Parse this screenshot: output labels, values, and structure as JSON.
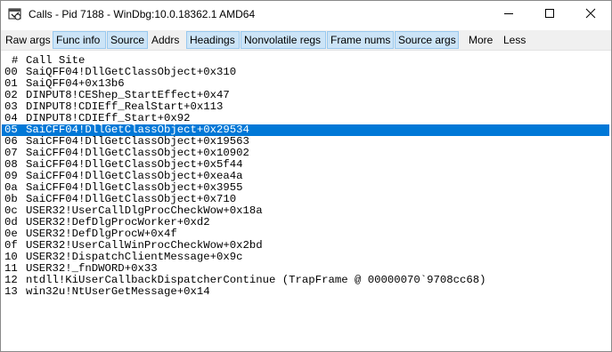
{
  "window": {
    "title": "Calls - Pid 7188 - WinDbg:10.0.18362.1 AMD64",
    "icons": [
      "windbg-app-icon",
      "minimize-icon",
      "maximize-icon",
      "close-icon"
    ]
  },
  "toolbar": {
    "buttons": [
      {
        "label": "Raw args",
        "active": false
      },
      {
        "label": "Func info",
        "active": true
      },
      {
        "label": "Source",
        "active": true
      },
      {
        "label": "Addrs",
        "active": false
      },
      {
        "label": "Headings",
        "active": true
      },
      {
        "label": "Nonvolatile regs",
        "active": true
      },
      {
        "label": "Frame nums",
        "active": true
      },
      {
        "label": "Source args",
        "active": true
      },
      {
        "label": "More",
        "active": false
      },
      {
        "label": "Less",
        "active": false
      }
    ]
  },
  "callstack": {
    "header": {
      "hash": "#",
      "label": "Call Site"
    },
    "selected_frame": "05",
    "frames": [
      {
        "num": "00",
        "site": "SaiQFF04!DllGetClassObject+0x310"
      },
      {
        "num": "01",
        "site": "SaiQFF04+0x13b6"
      },
      {
        "num": "02",
        "site": "DINPUT8!CEShep_StartEffect+0x47"
      },
      {
        "num": "03",
        "site": "DINPUT8!CDIEff_RealStart+0x113"
      },
      {
        "num": "04",
        "site": "DINPUT8!CDIEff_Start+0x92"
      },
      {
        "num": "05",
        "site": "SaiCFF04!DllGetClassObject+0x29534"
      },
      {
        "num": "06",
        "site": "SaiCFF04!DllGetClassObject+0x19563"
      },
      {
        "num": "07",
        "site": "SaiCFF04!DllGetClassObject+0x10902"
      },
      {
        "num": "08",
        "site": "SaiCFF04!DllGetClassObject+0x5f44"
      },
      {
        "num": "09",
        "site": "SaiCFF04!DllGetClassObject+0xea4a"
      },
      {
        "num": "0a",
        "site": "SaiCFF04!DllGetClassObject+0x3955"
      },
      {
        "num": "0b",
        "site": "SaiCFF04!DllGetClassObject+0x710"
      },
      {
        "num": "0c",
        "site": "USER32!UserCallDlgProcCheckWow+0x18a"
      },
      {
        "num": "0d",
        "site": "USER32!DefDlgProcWorker+0xd2"
      },
      {
        "num": "0e",
        "site": "USER32!DefDlgProcW+0x4f"
      },
      {
        "num": "0f",
        "site": "USER32!UserCallWinProcCheckWow+0x2bd"
      },
      {
        "num": "10",
        "site": "USER32!DispatchClientMessage+0x9c"
      },
      {
        "num": "11",
        "site": "USER32!_fnDWORD+0x33"
      },
      {
        "num": "12",
        "site": "ntdll!KiUserCallbackDispatcherContinue (TrapFrame @ 00000070`9708cc68)"
      },
      {
        "num": "13",
        "site": "win32u!NtUserGetMessage+0x14"
      }
    ]
  }
}
